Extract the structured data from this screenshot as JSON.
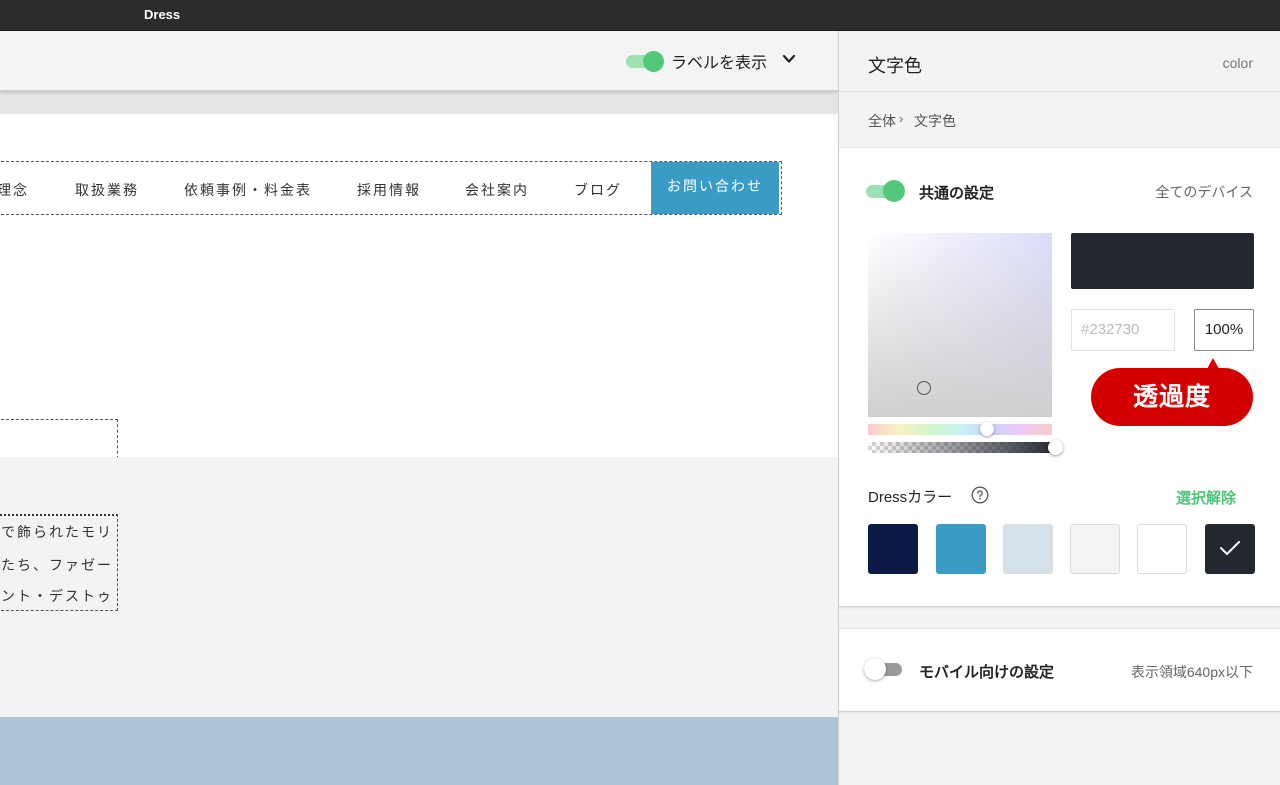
{
  "app": {
    "title": "Dress"
  },
  "topbar": {
    "label_toggle_text": "ラベルを表示"
  },
  "site": {
    "nav": [
      {
        "label": "理念"
      },
      {
        "label": "取扱業務"
      },
      {
        "label": "依頼事例・料金表"
      },
      {
        "label": "採用情報"
      },
      {
        "label": "会社案内"
      },
      {
        "label": "ブログ"
      }
    ],
    "nav_cta": "お問い合わせ",
    "text_lines": [
      "で飾られたモリ",
      "たち、ファゼー",
      "ント・デストゥ"
    ]
  },
  "panel": {
    "title": "文字色",
    "subtitle": "color",
    "breadcrumb": {
      "root": "全体",
      "separator": "›",
      "current": "文字色"
    },
    "common": {
      "label": "共通の設定",
      "scope": "全てのデバイス",
      "enabled": true
    },
    "picker": {
      "hex": "#232730",
      "alpha": "100%",
      "preview_color": "#232730",
      "callout": "透過度"
    },
    "dress_colors": {
      "label": "Dressカラー",
      "deselect": "選択解除",
      "swatches": [
        "#0b1a45",
        "#3a9cc4",
        "#d6e1e9",
        "#f4f4f4",
        "#ffffff",
        "#232730"
      ],
      "selected_index": 5
    },
    "mobile": {
      "label": "モバイル向けの設定",
      "scope": "表示領域640px以下",
      "enabled": false
    }
  },
  "colors": {
    "accent_green": "#52c97a",
    "cta_blue": "#3a9cc4",
    "callout_red": "#d40000"
  }
}
